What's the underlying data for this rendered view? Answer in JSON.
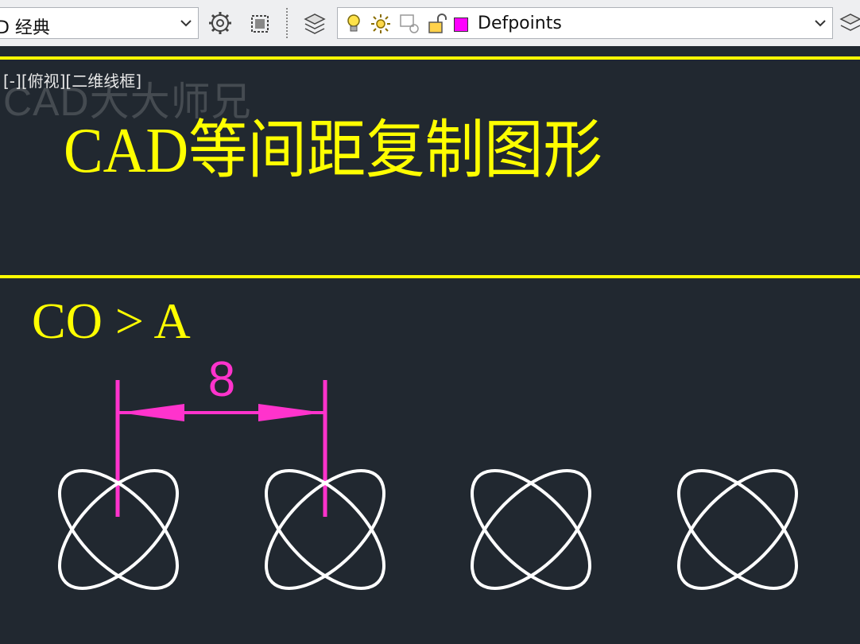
{
  "toolbar": {
    "workspace_value": "D 经典",
    "layer_value": "Defpoints",
    "layer_color": "#ff00ff"
  },
  "icons": [
    "gear-icon",
    "workspace-icon",
    "layer-properties-icon",
    "lightbulb-icon",
    "sun-icon",
    "freeze-viewport-icon",
    "lock-open-icon",
    "layer-color-swatch",
    "dropdown-chevron-icon"
  ],
  "viewport": {
    "label": "[-][俯视][二维线框]"
  },
  "watermark": "CAD大大师兄",
  "drawing": {
    "title": "CAD等间距复制图形",
    "command": "CO > A",
    "dimension_value": "8",
    "text_color": "#ffff00",
    "dimension_color": "#ff33cc",
    "geometry_color": "#ffffff",
    "shape_count": 4
  }
}
